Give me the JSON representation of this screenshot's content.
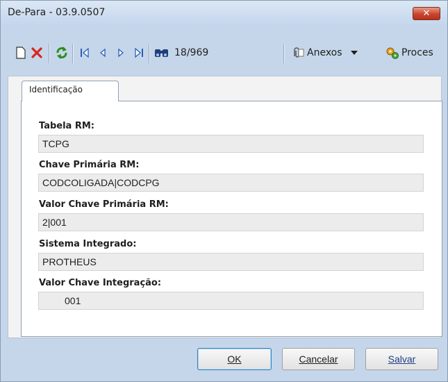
{
  "window": {
    "title": "De-Para - 03.9.0507",
    "close_label": "✕"
  },
  "toolbar": {
    "icons": [
      "new-record-icon",
      "delete-icon",
      "refresh-icon",
      "first-record-icon",
      "previous-record-icon",
      "next-record-icon",
      "last-record-icon",
      "binoculars-icon",
      "paperclip-icon",
      "dropdown-arrow-icon",
      "process-gears-icon"
    ],
    "record_position": "18/969",
    "anexos_label": "Anexos",
    "process_label": "Proces"
  },
  "tabs": [
    {
      "label": "Identificação"
    }
  ],
  "form": {
    "fields": [
      {
        "label": "Tabela RM:",
        "value": "TCPG"
      },
      {
        "label": "Chave Primária RM:",
        "value": "CODCOLIGADA|CODCPG"
      },
      {
        "label": "Valor Chave Primária RM:",
        "value": "2|001"
      },
      {
        "label": "Sistema Integrado:",
        "value": "PROTHEUS"
      },
      {
        "label": "Valor Chave Integração:",
        "value": "001"
      }
    ]
  },
  "buttons": {
    "ok": "OK",
    "cancel": "Cancelar",
    "save": "Salvar"
  },
  "colors": {
    "delete": "#d9261c",
    "refresh": "#2c8c1c",
    "nav": "#2a5fb8"
  }
}
